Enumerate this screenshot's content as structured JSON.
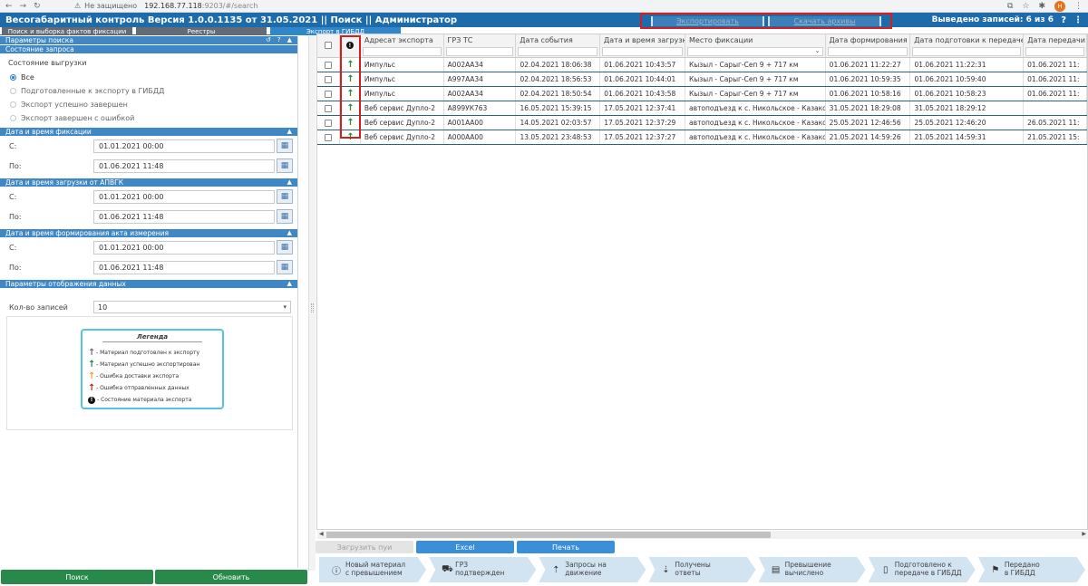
{
  "browser": {
    "security_label": "Не защищено",
    "url_host": "192.168.77.118",
    "url_rest": ":9203/#/search",
    "profile_initial": "Н"
  },
  "header": {
    "title": "Весогабаритный контроль Версия 1.0.0.1135 от 31.05.2021 || Поиск || Администратор",
    "export_btn": "Экспортировать",
    "download_btn": "Скачать архивы",
    "records_count": "Выведено записей: 6 из 6",
    "help_icon": "?"
  },
  "tabs": [
    {
      "label": "Поиск и выборка фактов фиксации",
      "active": false
    },
    {
      "label": "Реестры",
      "active": false
    },
    {
      "label": "Экспорт в ГИБДД",
      "active": true
    }
  ],
  "left": {
    "params_title": "Параметры поиска",
    "query_state_title": "Состояние запроса",
    "export_state_label": "Состояние выгрузки",
    "radios": [
      {
        "label": "Все",
        "selected": true
      },
      {
        "label": "Подготовленные к экспорту в ГИБДД",
        "selected": false
      },
      {
        "label": "Экспорт успешно завершен",
        "selected": false
      },
      {
        "label": "Экспорт завершен с ошибкой",
        "selected": false
      }
    ],
    "fix_title": "Дата и время фиксации",
    "fix_from_label": "С:",
    "fix_from": "01.01.2021 00:00",
    "fix_to_label": "По:",
    "fix_to": "01.06.2021 11:48",
    "load_title": "Дата и время загрузки от АПВГК",
    "load_from_label": "С:",
    "load_from": "01.01.2021 00:00",
    "load_to_label": "По:",
    "load_to": "01.06.2021 11:48",
    "act_title": "Дата и время формирования акта измерения",
    "act_from_label": "С:",
    "act_from": "01.01.2021 00:00",
    "act_to_label": "По:",
    "act_to": "01.06.2021 11:48",
    "display_title": "Параметры отображения данных",
    "count_label": "Кол-во записей",
    "count_value": "10",
    "legend_title": "Легенда",
    "legend": [
      {
        "color": "gray",
        "text": "- Материал подготовлен к экспорту"
      },
      {
        "color": "green",
        "text": "- Материал успешно экспортирован"
      },
      {
        "color": "orange",
        "text": "- Ошибка доставки экспорта"
      },
      {
        "color": "red",
        "text": "- Ошибка отправленных данных"
      },
      {
        "color": "black",
        "text": "- Состояние материала экспорта"
      }
    ],
    "search_btn": "Поиск",
    "refresh_btn": "Обновить"
  },
  "grid": {
    "columns": [
      "",
      "",
      "Адресат экспорта",
      "ГРЗ ТС",
      "Дата события",
      "Дата и время загрузки",
      "Место фиксации",
      "Дата формирования",
      "Дата подготовки к передаче",
      "Дата передачи"
    ],
    "rows": [
      [
        "Импульс",
        "А002АА34",
        "02.04.2021 18:06:38",
        "01.06.2021 10:43:57",
        "Кызыл - Сарыг-Сеп 9 + 717 км",
        "01.06.2021 11:22:27",
        "01.06.2021 11:22:31",
        "01.06.2021 11:"
      ],
      [
        "Импульс",
        "А997АА34",
        "02.04.2021 18:56:53",
        "01.06.2021 10:44:01",
        "Кызыл - Сарыг-Сеп 9 + 717 км",
        "01.06.2021 10:59:35",
        "01.06.2021 10:59:40",
        "01.06.2021 11:"
      ],
      [
        "Импульс",
        "А002АА34",
        "02.04.2021 18:50:54",
        "01.06.2021 10:43:58",
        "Кызыл - Сарыг-Сеп 9 + 717 км",
        "01.06.2021 10:58:16",
        "01.06.2021 10:58:23",
        "01.06.2021 11:"
      ],
      [
        "Веб сервис Дупло-2",
        "А899УК763",
        "16.05.2021 15:39:15",
        "17.05.2021 12:37:41",
        "автоподъезд к с. Никольское - Казаково от",
        "31.05.2021 18:29:08",
        "31.05.2021 18:29:12",
        ""
      ],
      [
        "Веб сервис Дупло-2",
        "А001АА00",
        "14.05.2021 02:03:57",
        "17.05.2021 12:37:29",
        "автоподъезд к с. Никольское - Казаково от",
        "25.05.2021 12:46:56",
        "25.05.2021 12:46:20",
        "26.05.2021 11:"
      ],
      [
        "Веб сервис Дупло-2",
        "А000АА00",
        "13.05.2021 23:48:53",
        "17.05.2021 12:37:27",
        "автоподъезд к с. Никольское - Казаково от",
        "21.05.2021 14:59:26",
        "21.05.2021 14:59:31",
        "21.05.2021 15:"
      ]
    ]
  },
  "actions": {
    "load_btn": "Загрузить пуи",
    "excel_btn": "Excel",
    "print_btn": "Печать"
  },
  "steps": [
    {
      "icon": "ⓘ",
      "l1": "Новый материал",
      "l2": "с превышением"
    },
    {
      "icon": "⛟",
      "l1": "ГРЗ",
      "l2": "подтвержден"
    },
    {
      "icon": "⇡",
      "l1": "Запросы на",
      "l2": "движение"
    },
    {
      "icon": "⇣",
      "l1": "Получены",
      "l2": "ответы"
    },
    {
      "icon": "▤",
      "l1": "Превышение",
      "l2": "вычислено"
    },
    {
      "icon": "▯",
      "l1": "Подготовлено к",
      "l2": "передаче в ГИБДД"
    },
    {
      "icon": "⚑",
      "l1": "Передано",
      "l2": "в ГИБДД"
    }
  ]
}
